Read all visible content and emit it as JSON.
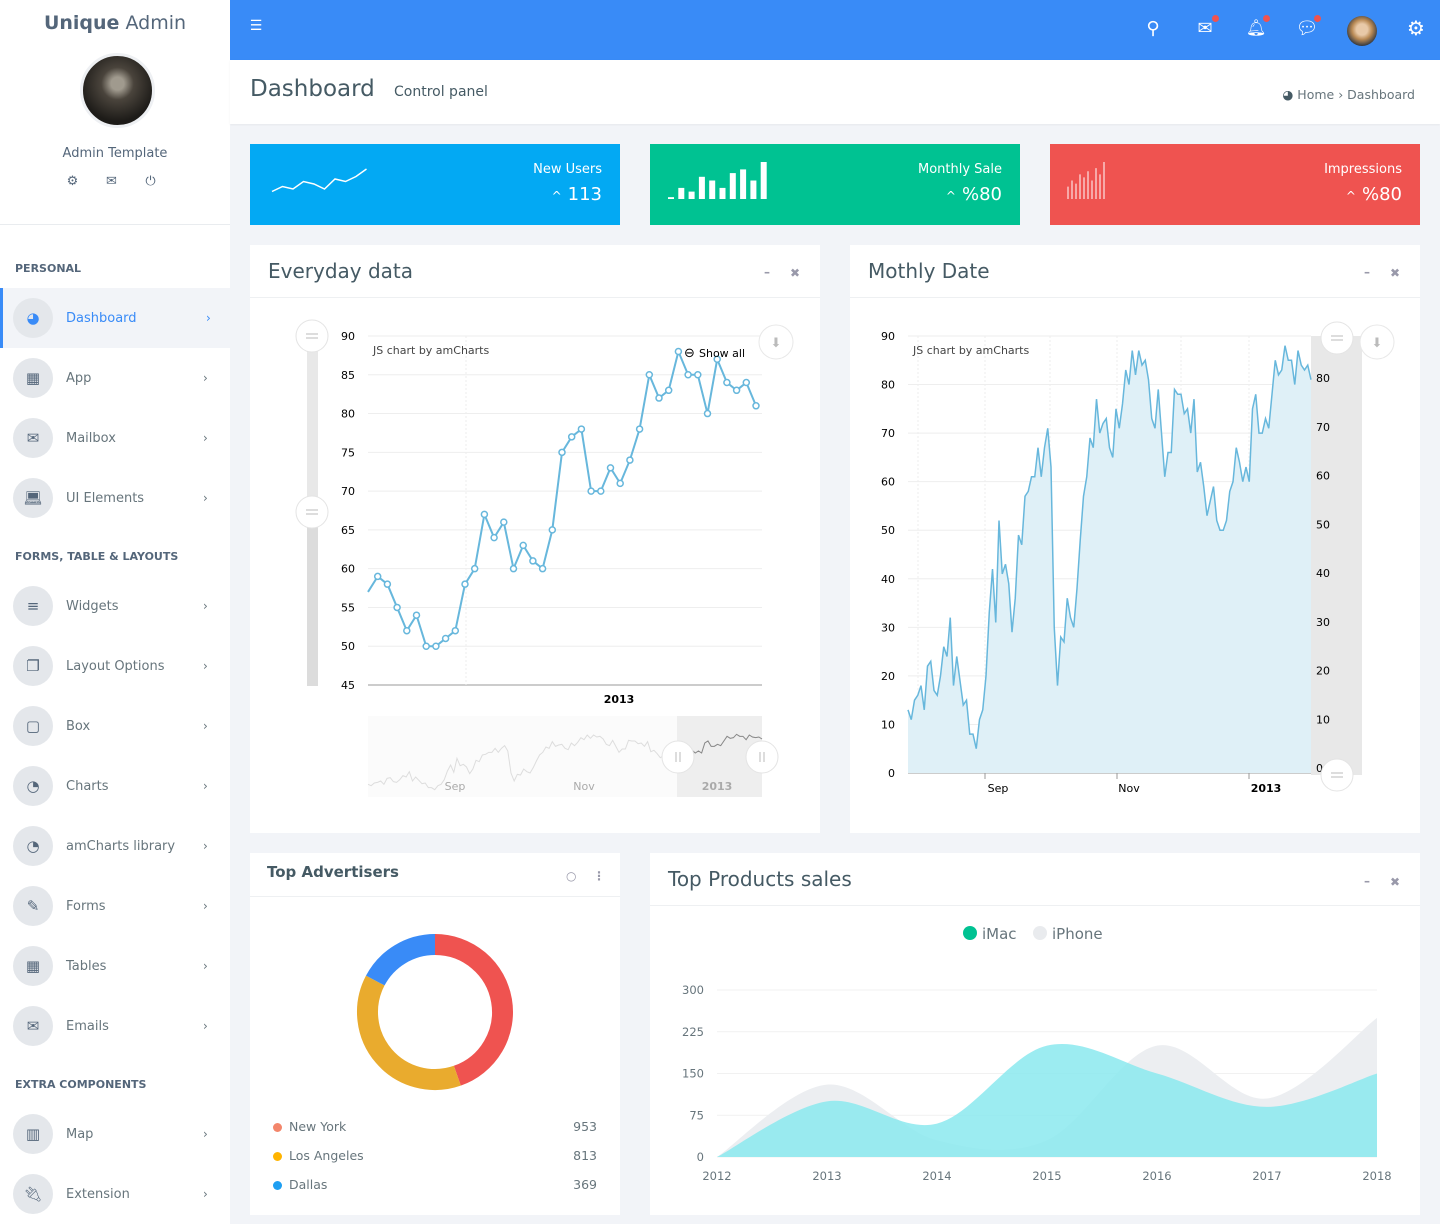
{
  "brand": {
    "bold": "Unique",
    "light": "Admin"
  },
  "user": {
    "name": "Admin Template",
    "actions": [
      "gear-icon",
      "mail-icon",
      "power-icon"
    ]
  },
  "sidebar": {
    "sections": [
      {
        "title": "PERSONAL",
        "items": [
          {
            "label": "Dashboard",
            "icon": "dashboard-icon",
            "active": true
          },
          {
            "label": "App",
            "icon": "grid-icon"
          },
          {
            "label": "Mailbox",
            "icon": "mail-icon"
          },
          {
            "label": "UI Elements",
            "icon": "laptop-icon"
          }
        ]
      },
      {
        "title": "FORMS, TABLE & LAYOUTS",
        "items": [
          {
            "label": "Widgets",
            "icon": "bars-icon"
          },
          {
            "label": "Layout Options",
            "icon": "copy-icon"
          },
          {
            "label": "Box",
            "icon": "square-icon"
          },
          {
            "label": "Charts",
            "icon": "pie-chart-icon"
          },
          {
            "label": "amCharts library",
            "icon": "pie-chart-icon"
          },
          {
            "label": "Forms",
            "icon": "edit-icon"
          },
          {
            "label": "Tables",
            "icon": "table-icon"
          },
          {
            "label": "Emails",
            "icon": "envelope-open-icon"
          }
        ]
      },
      {
        "title": "EXTRA COMPONENTS",
        "items": [
          {
            "label": "Map",
            "icon": "map-icon"
          },
          {
            "label": "Extension",
            "icon": "plug-icon"
          }
        ]
      }
    ]
  },
  "page": {
    "title": "Dashboard",
    "subtitle": "Control panel"
  },
  "breadcrumb": {
    "home": "Home",
    "current": "Dashboard"
  },
  "stats": [
    {
      "label": "New Users",
      "value": "113",
      "color": "#03a9f3",
      "spark": [
        3,
        5,
        4,
        7,
        6,
        4,
        8,
        7,
        9,
        12
      ]
    },
    {
      "label": "Monthly Sale",
      "value": "%80",
      "color": "#00c292",
      "spark": [
        0.5,
        3,
        2,
        6,
        5,
        3,
        7,
        8,
        5,
        10
      ]
    },
    {
      "label": "Impressions",
      "value": "%80",
      "color": "#ef5350",
      "spark": [
        4,
        6,
        5,
        8,
        7,
        9,
        6,
        10,
        8,
        12
      ]
    }
  ],
  "panels": {
    "everyday": {
      "title": "Everyday data",
      "credit": "JS chart by amCharts",
      "show_all": "Show all"
    },
    "monthly": {
      "title": "Mothly Date",
      "credit": "JS chart by amCharts"
    },
    "advertisers": {
      "title": "Top Advertisers"
    },
    "products": {
      "title": "Top Products sales"
    }
  },
  "chart_data": [
    {
      "id": "everyday",
      "type": "line",
      "ylim": [
        45,
        90
      ],
      "yticks": [
        45,
        50,
        55,
        60,
        65,
        70,
        75,
        80,
        85,
        90
      ],
      "xlabels": [
        "2013"
      ],
      "scroll_labels": [
        "Sep",
        "Nov",
        "2013"
      ],
      "color": "#67b7dc",
      "values": [
        57,
        59,
        58,
        55,
        52,
        54,
        50,
        50,
        51,
        52,
        58,
        60,
        67,
        64,
        66,
        60,
        63,
        61,
        60,
        65,
        75,
        77,
        78,
        70,
        70,
        73,
        71,
        74,
        78,
        85,
        82,
        83,
        88,
        85,
        85,
        80,
        87,
        84,
        83,
        84,
        81
      ]
    },
    {
      "id": "monthly",
      "type": "area",
      "ylim": [
        0,
        90
      ],
      "yticks": [
        0,
        10,
        20,
        30,
        40,
        50,
        60,
        70,
        80,
        90
      ],
      "right_ticks": [
        0,
        10,
        20,
        30,
        40,
        50,
        60,
        70,
        80
      ],
      "xlabels": [
        "Sep",
        "Nov",
        "2013"
      ],
      "color": "#67b7dc",
      "values": [
        13,
        11,
        15,
        16,
        18,
        13,
        22,
        23,
        17,
        16,
        20,
        26,
        24,
        32,
        18,
        24,
        19,
        14,
        15,
        8,
        8,
        5,
        11,
        13,
        20,
        33,
        42,
        31,
        52,
        41,
        43,
        39,
        29,
        36,
        49,
        47,
        57,
        58,
        61,
        61,
        67,
        61,
        67,
        71,
        63,
        30,
        18,
        28,
        27,
        36,
        32,
        30,
        38,
        48,
        57,
        61,
        69,
        67,
        77,
        70,
        72,
        73,
        67,
        65,
        75,
        71,
        76,
        83,
        80,
        87,
        82,
        87,
        84,
        85,
        81,
        73,
        71,
        79,
        70,
        61,
        66,
        66,
        79,
        78,
        78,
        74,
        75,
        70,
        77,
        62,
        64,
        59,
        53,
        56,
        59,
        52,
        50,
        50,
        52,
        58,
        60,
        67,
        64,
        60,
        63,
        60,
        75,
        78,
        70,
        70,
        73,
        71,
        78,
        85,
        82,
        83,
        88,
        85,
        85,
        80,
        87,
        84,
        83,
        84,
        81
      ]
    },
    {
      "id": "products",
      "type": "area",
      "categories": [
        "2012",
        "2013",
        "2014",
        "2015",
        "2016",
        "2017",
        "2018"
      ],
      "ylim": [
        0,
        300
      ],
      "yticks": [
        0,
        75,
        150,
        225,
        300
      ],
      "legend": "top-center",
      "series": [
        {
          "name": "iMac",
          "color": "#00c292",
          "fill": "#8be9ef",
          "values": [
            0,
            100,
            60,
            200,
            150,
            90,
            150
          ]
        },
        {
          "name": "iPhone",
          "color": "#e9ebee",
          "fill": "#eceef1",
          "values": [
            0,
            130,
            30,
            30,
            200,
            105,
            250
          ]
        }
      ]
    },
    {
      "id": "advertisers",
      "type": "pie",
      "labels": [
        "New York",
        "Los Angeles",
        "Dallas"
      ],
      "values": [
        953,
        813,
        369
      ],
      "colors": [
        "#ef5350",
        "#e9ab2e",
        "#398bf7"
      ],
      "legend_colors": [
        "#f3866b",
        "#ffb400",
        "#1e9ff2"
      ]
    }
  ]
}
